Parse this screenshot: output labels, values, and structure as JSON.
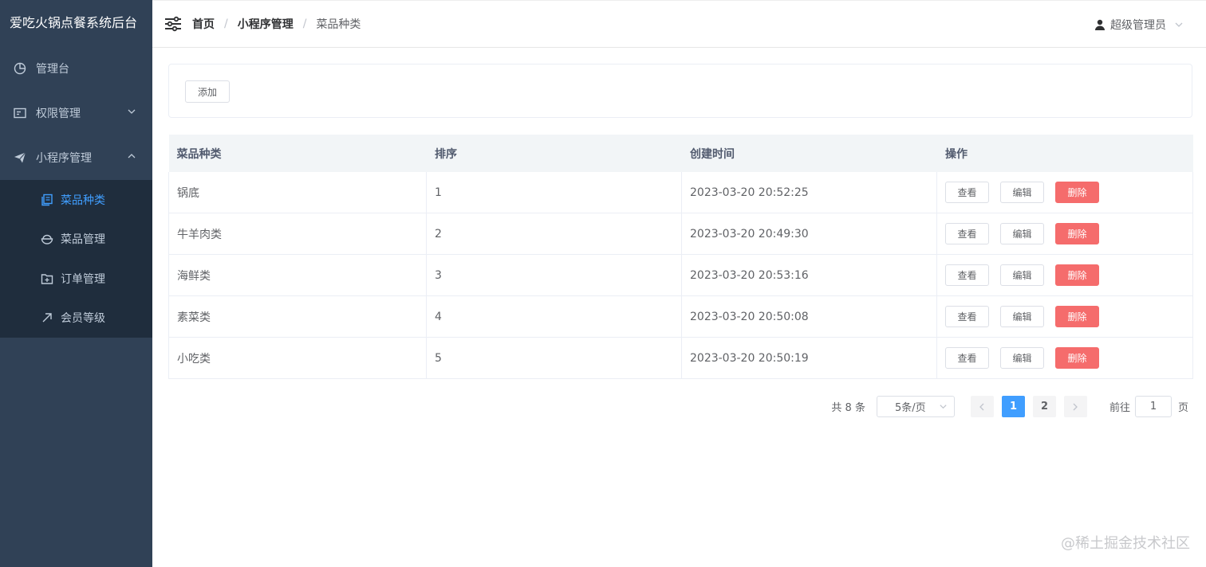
{
  "app": {
    "title": "爱吃火锅点餐系统后台"
  },
  "sidebar": {
    "items": [
      {
        "label": "管理台",
        "icon": "pie-chart-icon"
      },
      {
        "label": "权限管理",
        "icon": "id-card-icon",
        "expanded": false
      },
      {
        "label": "小程序管理",
        "icon": "send-icon",
        "expanded": true
      }
    ],
    "subitems": [
      {
        "label": "菜品种类",
        "icon": "copy-icon",
        "active": true
      },
      {
        "label": "菜品管理",
        "icon": "bowl-icon",
        "active": false
      },
      {
        "label": "订单管理",
        "icon": "folder-add-icon",
        "active": false
      },
      {
        "label": "会员等级",
        "icon": "top-right-arrow-icon",
        "active": false
      }
    ]
  },
  "header": {
    "breadcrumb": [
      "首页",
      "小程序管理",
      "菜品种类"
    ],
    "separator": "/",
    "user": "超级管理员"
  },
  "toolbar": {
    "add_label": "添加"
  },
  "table": {
    "columns": [
      "菜品种类",
      "排序",
      "创建时间",
      "操作"
    ],
    "rows": [
      {
        "name": "锅底",
        "sort": "1",
        "created": "2023-03-20 20:52:25"
      },
      {
        "name": "牛羊肉类",
        "sort": "2",
        "created": "2023-03-20 20:49:30"
      },
      {
        "name": "海鲜类",
        "sort": "3",
        "created": "2023-03-20 20:53:16"
      },
      {
        "name": "素菜类",
        "sort": "4",
        "created": "2023-03-20 20:50:08"
      },
      {
        "name": "小吃类",
        "sort": "5",
        "created": "2023-03-20 20:50:19"
      }
    ],
    "actions": {
      "view": "查看",
      "edit": "编辑",
      "delete": "删除"
    }
  },
  "pagination": {
    "total_text": "共 8 条",
    "page_size": "5条/页",
    "pages": [
      "1",
      "2"
    ],
    "current_page": "1",
    "jump_prefix": "前往",
    "jump_value": "1",
    "jump_suffix": "页"
  },
  "watermark": "@稀土掘金技术社区",
  "colors": {
    "sidebar_bg": "#304156",
    "submenu_bg": "#1f2d3d",
    "accent": "#409eff",
    "danger": "#f56c6c"
  }
}
